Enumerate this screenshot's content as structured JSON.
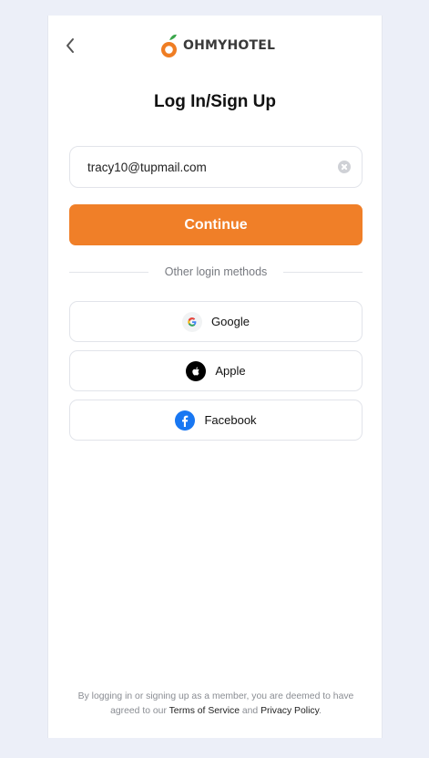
{
  "header": {
    "back_icon": "chevron-left-icon",
    "logo_text": "OHMYHOTEL",
    "logo_icon": "orange-logo-icon"
  },
  "page": {
    "title": "Log In/Sign Up"
  },
  "email": {
    "value": "tracy10@tupmail.com",
    "clear_icon": "clear-icon"
  },
  "continue": {
    "label": "Continue"
  },
  "divider": {
    "label": "Other login methods"
  },
  "social": [
    {
      "label": "Google",
      "icon": "google-icon"
    },
    {
      "label": "Apple",
      "icon": "apple-icon"
    },
    {
      "label": "Facebook",
      "icon": "facebook-icon"
    }
  ],
  "footer": {
    "prefix": "By logging in or signing up as a member, you are deemed to have agreed to our",
    "terms": "Terms of Service",
    "and": "and",
    "privacy": "Privacy Policy",
    "suffix": "."
  },
  "colors": {
    "accent": "#f07f28",
    "background": "#eceff8",
    "facebook": "#1877f2"
  }
}
